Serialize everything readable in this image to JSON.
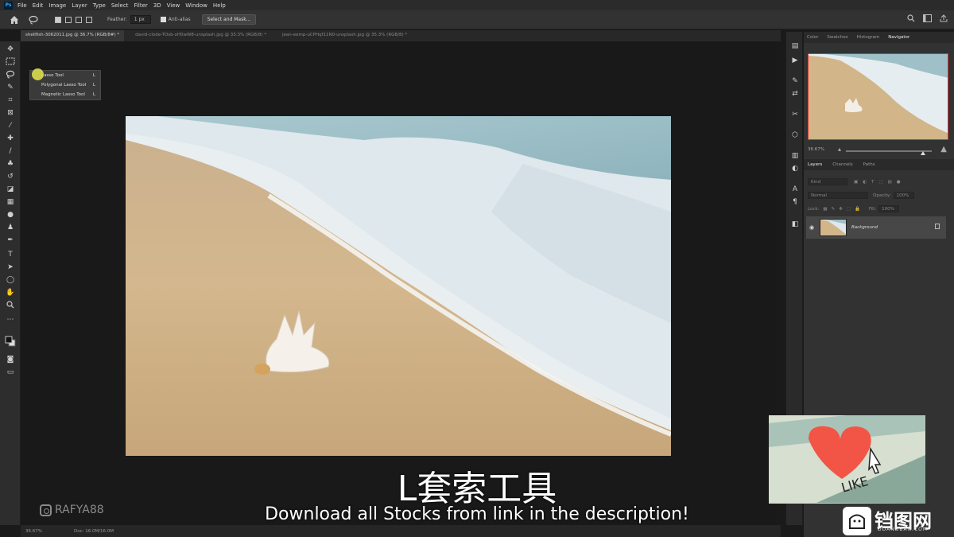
{
  "app": {
    "logo": "Ps"
  },
  "menu": [
    "File",
    "Edit",
    "Image",
    "Layer",
    "Type",
    "Select",
    "Filter",
    "3D",
    "View",
    "Window",
    "Help"
  ],
  "options": {
    "feather_label": "Feather:",
    "feather_value": "1 px",
    "antialias_label": "Anti-alias",
    "select_mask_label": "Select and Mask..."
  },
  "tabs": [
    {
      "label": "shellfish-3062011.jpg @ 36.7% (RGB/8#) *",
      "active": true
    },
    {
      "label": "david-clode-TOsb-xH0wW8-unsplash.jpg @ 33.3% (RGB/8) *",
      "active": false
    },
    {
      "label": "jean-eemp-uCPHqf11N0-unsplash.jpg @ 35.3% (RGB/8) *",
      "active": false
    }
  ],
  "flyout": [
    {
      "label": "Lasso Tool",
      "key": "L"
    },
    {
      "label": "Polygonal Lasso Tool",
      "key": "L"
    },
    {
      "label": "Magnetic Lasso Tool",
      "key": "L"
    }
  ],
  "panel_tabs": [
    {
      "label": "Color",
      "active": false
    },
    {
      "label": "Swatches",
      "active": false
    },
    {
      "label": "Histogram",
      "active": false
    },
    {
      "label": "Navigator",
      "active": true
    }
  ],
  "navigator": {
    "zoom": "36.67%"
  },
  "layers_tabs": [
    {
      "label": "Layers",
      "active": true
    },
    {
      "label": "Channels",
      "active": false
    },
    {
      "label": "Paths",
      "active": false
    }
  ],
  "layers": {
    "kind": "Kind",
    "blend": "Normal",
    "opacity_label": "Opacity:",
    "opacity": "100%",
    "lock_label": "Lock:",
    "fill_label": "Fill:",
    "fill": "100%",
    "layer_name": "Background"
  },
  "status": {
    "zoom": "36.67%",
    "doc": "Doc: 16.0M/16.0M"
  },
  "overlay": {
    "subtitle_zh": "L套索工具",
    "subtitle_en": "Download all Stocks from link in the description!",
    "watermark": "RAFYA88",
    "like_text": "LIKE",
    "site_logo": "铛图网",
    "site_sub": "DDANDBAN.COM"
  },
  "colors": {
    "accent": "#31a8ff",
    "selection": "#dd3333"
  }
}
